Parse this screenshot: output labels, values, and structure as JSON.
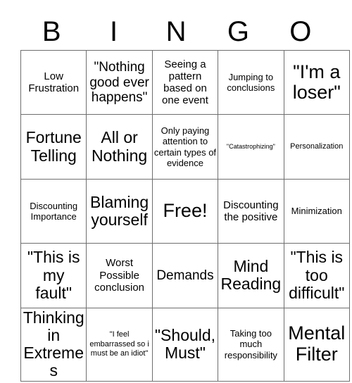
{
  "card": {
    "header_letters": [
      "B",
      "I",
      "N",
      "G",
      "O"
    ],
    "free_space_label": "Free!",
    "colors": {
      "background": "#ffffff",
      "text": "#000000",
      "grid_line": "#6e6e6e"
    },
    "rows": [
      [
        {
          "text": "Low Frustration",
          "size": "fs-md"
        },
        {
          "text": "\"Nothing good ever happens\"",
          "size": "fs-lg"
        },
        {
          "text": "Seeing a pattern based on one event",
          "size": "fs-md"
        },
        {
          "text": "Jumping to conclusions",
          "size": "fs-sm"
        },
        {
          "text": "\"I'm a loser\"",
          "size": "fs-xxl"
        }
      ],
      [
        {
          "text": "Fortune Telling",
          "size": "fs-xl"
        },
        {
          "text": "All or Nothing",
          "size": "fs-xl"
        },
        {
          "text": "Only paying attention to certain types of evidence",
          "size": "fs-sm"
        },
        {
          "text": "\"Catastrophizing\"",
          "size": "fs-xxs"
        },
        {
          "text": "Personalization",
          "size": "fs-xs"
        }
      ],
      [
        {
          "text": "Discounting Importance",
          "size": "fs-sm"
        },
        {
          "text": "Blaming yourself",
          "size": "fs-xl"
        },
        {
          "text": "Free!",
          "size": "fs-xxl"
        },
        {
          "text": "Discounting the positive",
          "size": "fs-md"
        },
        {
          "text": "Minimization",
          "size": "fs-sm"
        }
      ],
      [
        {
          "text": "\"This is my fault\"",
          "size": "fs-xl"
        },
        {
          "text": "Worst Possible conclusion",
          "size": "fs-md"
        },
        {
          "text": "Demands",
          "size": "fs-lg"
        },
        {
          "text": "Mind Reading",
          "size": "fs-xl"
        },
        {
          "text": "\"This is too difficult\"",
          "size": "fs-xl"
        }
      ],
      [
        {
          "text": "Thinking in Extremes",
          "size": "fs-xl"
        },
        {
          "text": "\"I feel embarrassed so i must be an idiot\"",
          "size": "fs-xs"
        },
        {
          "text": "\"Should, Must\"",
          "size": "fs-xl"
        },
        {
          "text": "Taking too much responsibility",
          "size": "fs-sm"
        },
        {
          "text": "Mental Filter",
          "size": "fs-xxl"
        }
      ]
    ]
  }
}
